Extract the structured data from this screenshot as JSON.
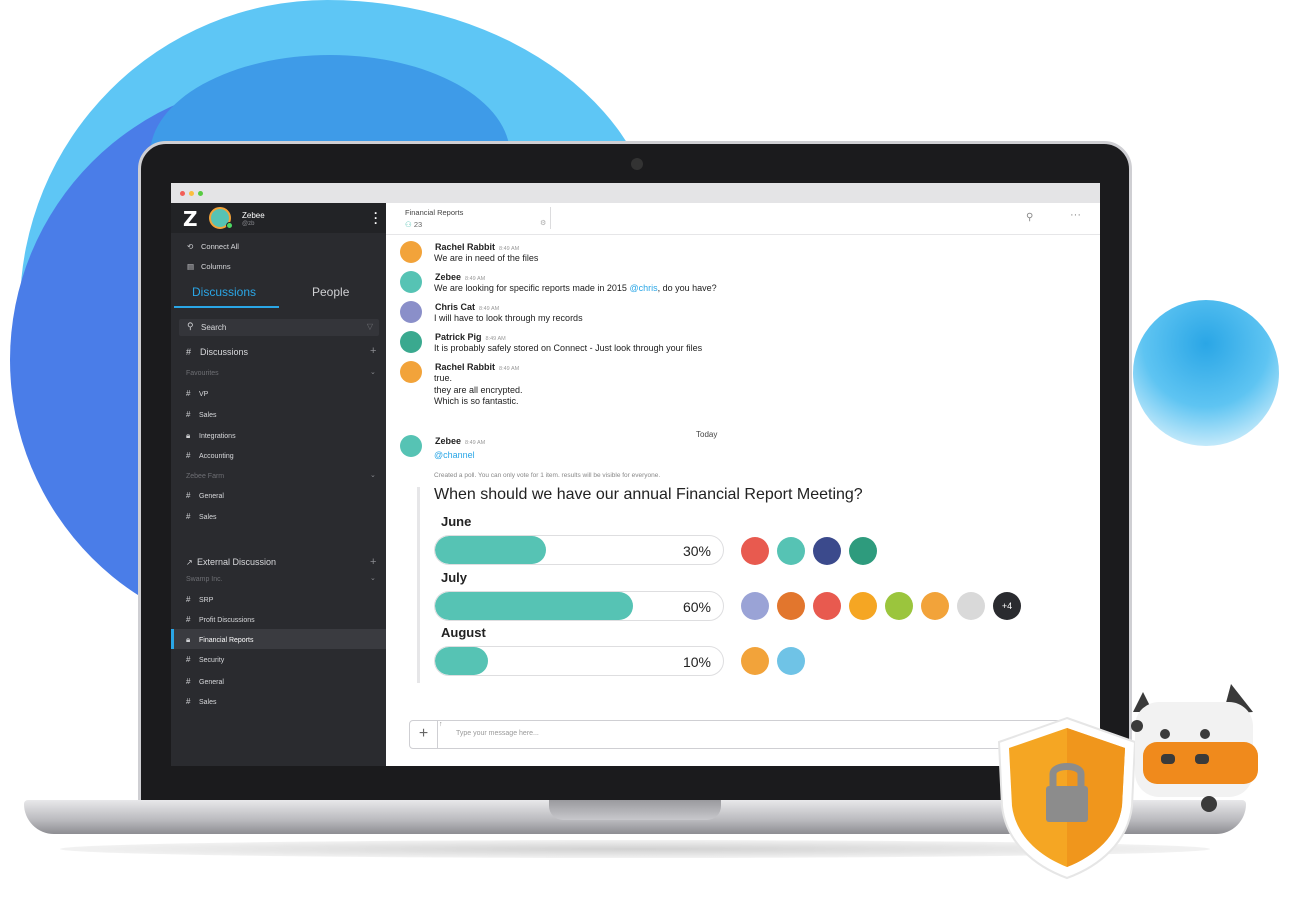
{
  "app": {
    "user": {
      "name": "Zebee",
      "handle": "@zb",
      "logo": "Z"
    },
    "sidebar": {
      "links": [
        {
          "label": "Connect All",
          "icon": "connect-icon"
        },
        {
          "label": "Columns",
          "icon": "columns-icon"
        }
      ],
      "tabs": {
        "active": "Discussions",
        "other": "People"
      },
      "search_placeholder": "Search",
      "sections": {
        "discussions": "Discussions",
        "external": "External Discussion"
      },
      "groups": {
        "favourites": "Favourites",
        "zebee_farm": "Zebee Farm",
        "swamp_inc": "Swamp Inc."
      },
      "favourites": [
        "VP",
        "Sales",
        "Integrations",
        "Accounting"
      ],
      "zebee_farm": [
        "General",
        "Sales"
      ],
      "swamp_inc": [
        "SRP",
        "Profit Discussions",
        "Financial Reports",
        "Security",
        "General",
        "Sales"
      ],
      "active_channel": "Financial Reports"
    },
    "header": {
      "title": "Financial Reports",
      "member_count": "23"
    },
    "messages": [
      {
        "author": "Rachel Rabbit",
        "time": "8:49 AM",
        "lines": [
          "We are in need of the files"
        ],
        "avatar_color": "#f2a33a"
      },
      {
        "author": "Zebee",
        "time": "8:49 AM",
        "text_before": "We are looking for specific reports made in 2015 ",
        "mention": "@chris",
        "text_after": ", do you have?",
        "avatar_color": "#56c3b4"
      },
      {
        "author": "Chris Cat",
        "time": "8:49 AM",
        "lines": [
          "I will have to look through my records"
        ],
        "avatar_color": "#8a8fc9"
      },
      {
        "author": "Patrick Pig",
        "time": "8:49 AM",
        "lines": [
          "It is probably safely stored on Connect - Just look through your files"
        ],
        "avatar_color": "#3aa98f"
      },
      {
        "author": "Rachel Rabbit",
        "time": "8:49 AM",
        "lines": [
          "true.",
          "they are all encrypted.",
          "Which is so fantastic."
        ],
        "avatar_color": "#f2a33a"
      }
    ],
    "day_divider": "Today",
    "poll_message": {
      "author": "Zebee",
      "time": "8:49 AM",
      "mention": "@channel",
      "note": "Created a poll. You can only vote for 1 item. results will be visible for everyone.",
      "question": "When should we have our annual Financial Report Meeting?",
      "options": [
        {
          "label": "June",
          "percent_label": "30%",
          "percent": 30,
          "voter_colors": [
            "#e85a4f",
            "#56c3b4",
            "#3b4a8c",
            "#2e9b7d"
          ]
        },
        {
          "label": "July",
          "percent_label": "60%",
          "percent": 60,
          "voter_colors": [
            "#9aa3d6",
            "#e2762d",
            "#e85a4f",
            "#f5a623",
            "#9bc53d",
            "#f2a33a",
            "#d9d9d9"
          ],
          "more": "+4"
        },
        {
          "label": "August",
          "percent_label": "10%",
          "percent": 10,
          "voter_colors": [
            "#f2a33a",
            "#6fc3e6"
          ]
        }
      ]
    },
    "composer": {
      "placeholder": "Type your message here..."
    },
    "colors": {
      "accent": "#2aa6e6",
      "poll_bar": "#56c3b4",
      "sidebar_bg": "#2a2b2f"
    }
  }
}
